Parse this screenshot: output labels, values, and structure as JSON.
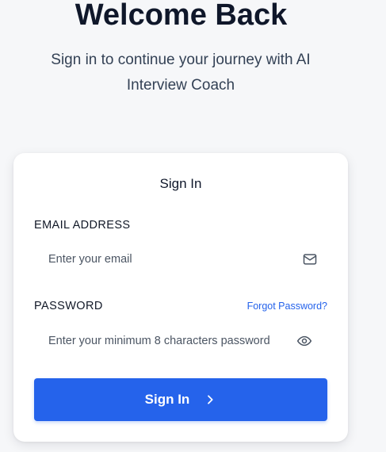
{
  "header": {
    "title": "Welcome Back",
    "subtitle": "Sign in to continue your journey with AI Interview Coach"
  },
  "card": {
    "title": "Sign In",
    "email": {
      "label": "EMAIL ADDRESS",
      "placeholder": "Enter your email",
      "value": "",
      "icon": "mail-icon"
    },
    "password": {
      "label": "PASSWORD",
      "placeholder": "Enter your minimum 8 characters password",
      "value": "",
      "icon": "eye-icon",
      "forgot_label": "Forgot Password?"
    },
    "submit": {
      "label": "Sign In",
      "icon": "chevron-right-icon"
    }
  },
  "colors": {
    "accent": "#2563eb",
    "background": "#f6f7f9",
    "heading": "#0f172a"
  }
}
